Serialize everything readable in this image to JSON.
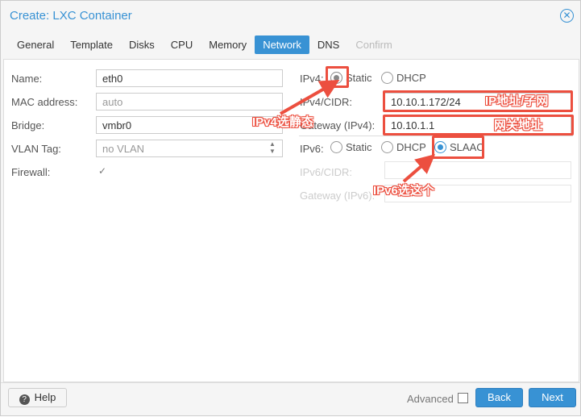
{
  "dialog": {
    "title": "Create: LXC Container"
  },
  "tabs": [
    {
      "label": "General"
    },
    {
      "label": "Template"
    },
    {
      "label": "Disks"
    },
    {
      "label": "CPU"
    },
    {
      "label": "Memory"
    },
    {
      "label": "Network"
    },
    {
      "label": "DNS"
    },
    {
      "label": "Confirm"
    }
  ],
  "left": {
    "name_label": "Name:",
    "name_value": "eth0",
    "mac_label": "MAC address:",
    "mac_placeholder": "auto",
    "bridge_label": "Bridge:",
    "bridge_value": "vmbr0",
    "vlan_label": "VLAN Tag:",
    "vlan_placeholder": "no VLAN",
    "firewall_label": "Firewall:",
    "firewall_checked": true
  },
  "right": {
    "ipv4_label": "IPv4:",
    "static": "Static",
    "dhcp": "DHCP",
    "slaac": "SLAAC",
    "ipv4_selected": "Static",
    "ipv4_cidr_label": "IPv4/CIDR:",
    "ipv4_cidr_value": "10.10.1.172/24",
    "gw4_label": "Gateway (IPv4):",
    "gw4_value": "10.10.1.1",
    "ipv6_label": "IPv6:",
    "ipv6_selected": "SLAAC",
    "ipv6_cidr_label": "IPv6/CIDR:",
    "gw6_label": "Gateway (IPv6):"
  },
  "annotations": {
    "ipv4": "IPv4选静态",
    "ip": "IP地址/子网",
    "gw": "网关地址",
    "ipv6": "IPv6选这个"
  },
  "footer": {
    "help": "Help",
    "advanced": "Advanced",
    "back": "Back",
    "next": "Next"
  }
}
